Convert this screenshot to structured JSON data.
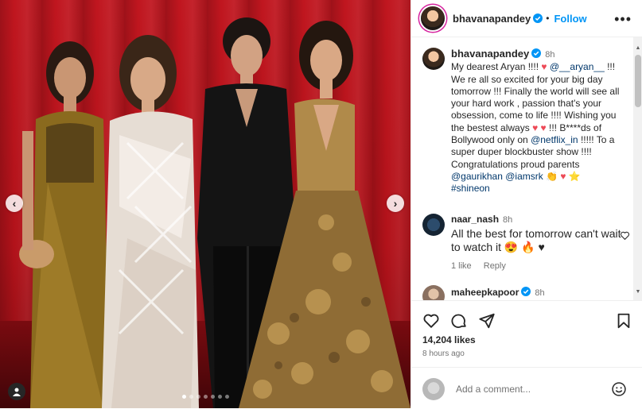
{
  "post": {
    "photo": {
      "carousel_dots": 7,
      "active_dot": 0,
      "prev_label": "‹",
      "next_label": "›"
    },
    "author": {
      "username": "bhavanapandey",
      "follow_label": "Follow",
      "verified": true
    },
    "caption": {
      "username": "bhavanapandey",
      "time": "8h",
      "text_1": "My dearest Aryan !!!! ",
      "emoji_1": "♥",
      "mention_1": "@__aryan__",
      "text_2": " !!! We re all so excited  for your big day tomorrow !!! Finally the world will see all your hard work , passion that's your obsession, come to life !!!! Wishing you the bestest always ",
      "emoji_2": "♥ ♥",
      "text_3": " !!! B****ds of Bollywood only on ",
      "mention_2": "@netflix_in",
      "text_4": " !!!!! To a super duper blockbuster show !!!! Congratulations proud parents ",
      "mention_3": "@gaurikhan",
      "mention_4": "@iamsrk",
      "emoji_3": "👏 ♥ ⭐",
      "hashtag": "#shineon"
    },
    "comments": [
      {
        "username": "naar_nash",
        "time": "8h",
        "text": "All the best for tomorrow can't wait to watch it 😍 🔥 ♥",
        "likes_label": "1 like",
        "reply_label": "Reply"
      },
      {
        "username": "maheepkapoor",
        "time": "8h",
        "verified": true
      }
    ],
    "likes_label": "14,204 likes",
    "time_ago": "8 hours ago",
    "add_comment_placeholder": "Add a comment...",
    "colors": {
      "link": "#00376b",
      "follow": "#0095f6",
      "heart": "#ed4956",
      "verified": "#0095f6"
    }
  }
}
